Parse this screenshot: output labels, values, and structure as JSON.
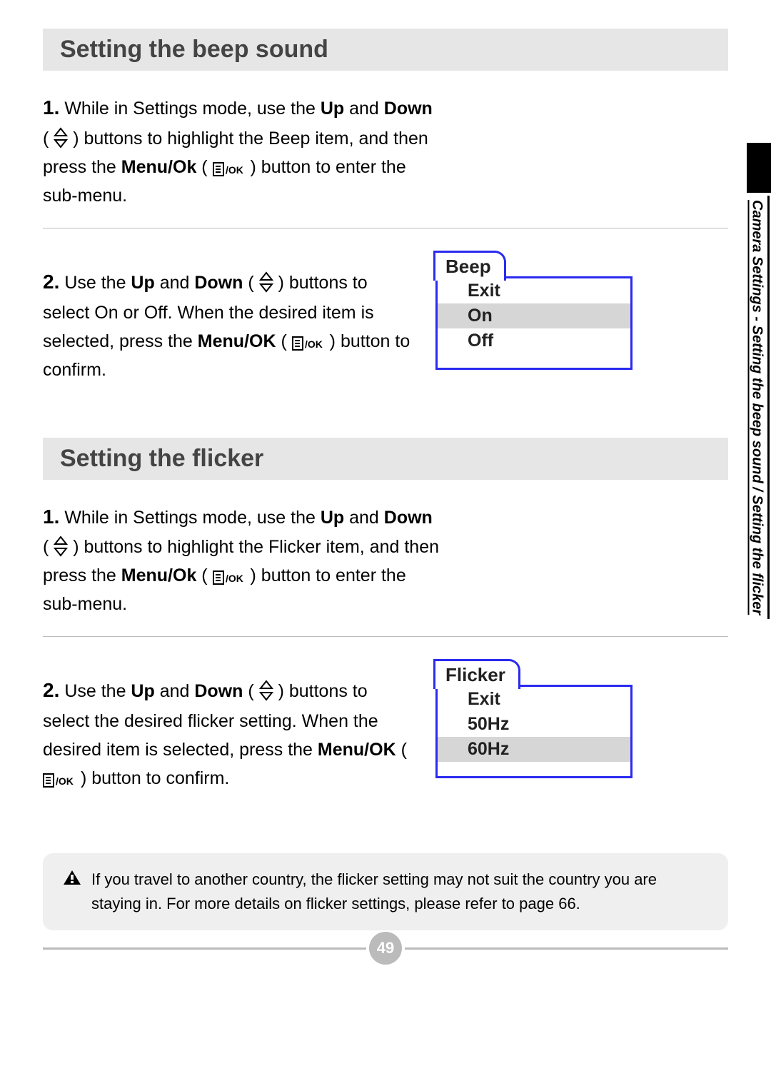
{
  "page_number": "49",
  "side_tab": "Camera Settings - Setting the beep sound / Setting the flicker",
  "sections": {
    "beep": {
      "heading": "Setting the beep sound",
      "step1_a": "While in Settings mode, use the ",
      "step1_up": "Up",
      "step1_and1": " and ",
      "step1_down": "Down",
      "step1_b": " ( ",
      "step1_c": " ) buttons to highlight the Beep item, and then press the ",
      "step1_menu": "Menu/Ok",
      "step1_d": " ( ",
      "step1_e": " ) button to enter the sub-menu.",
      "step2_a": "Use the ",
      "step2_up": "Up",
      "step2_and": " and ",
      "step2_down": "Down",
      "step2_b": " ( ",
      "step2_c": " ) buttons to select On or Off. When the desired item is selected, press the ",
      "step2_menu": "Menu/OK",
      "step2_d": " ( ",
      "step2_e": " ) button to confirm.",
      "lcd": {
        "tab": "Beep",
        "items": [
          "Exit",
          "On",
          "Off"
        ],
        "highlight_index": 1
      }
    },
    "flicker": {
      "heading": "Setting the flicker",
      "step1_a": "While in Settings mode, use the ",
      "step1_up": "Up",
      "step1_and1": " and ",
      "step1_down": "Down",
      "step1_b": " ( ",
      "step1_c": " ) buttons to highlight the Flicker item, and then press the ",
      "step1_menu": "Menu/Ok",
      "step1_d": " ( ",
      "step1_e": " ) button to enter the sub-menu.",
      "step2_a": "Use the ",
      "step2_up": "Up",
      "step2_and": " and ",
      "step2_down": "Down",
      "step2_b": " ( ",
      "step2_c": " ) buttons to select the desired flicker setting. When the desired item is selected, press the ",
      "step2_menu": "Menu/OK",
      "step2_d": " ( ",
      "step2_e": " ) button to confirm.",
      "lcd": {
        "tab": "Flicker",
        "items": [
          "Exit",
          "50Hz",
          "60Hz"
        ],
        "highlight_index": 2
      }
    }
  },
  "note": "If you travel to another country, the flicker setting may not suit the country you are staying in. For more details on flicker settings, please refer to page 66."
}
